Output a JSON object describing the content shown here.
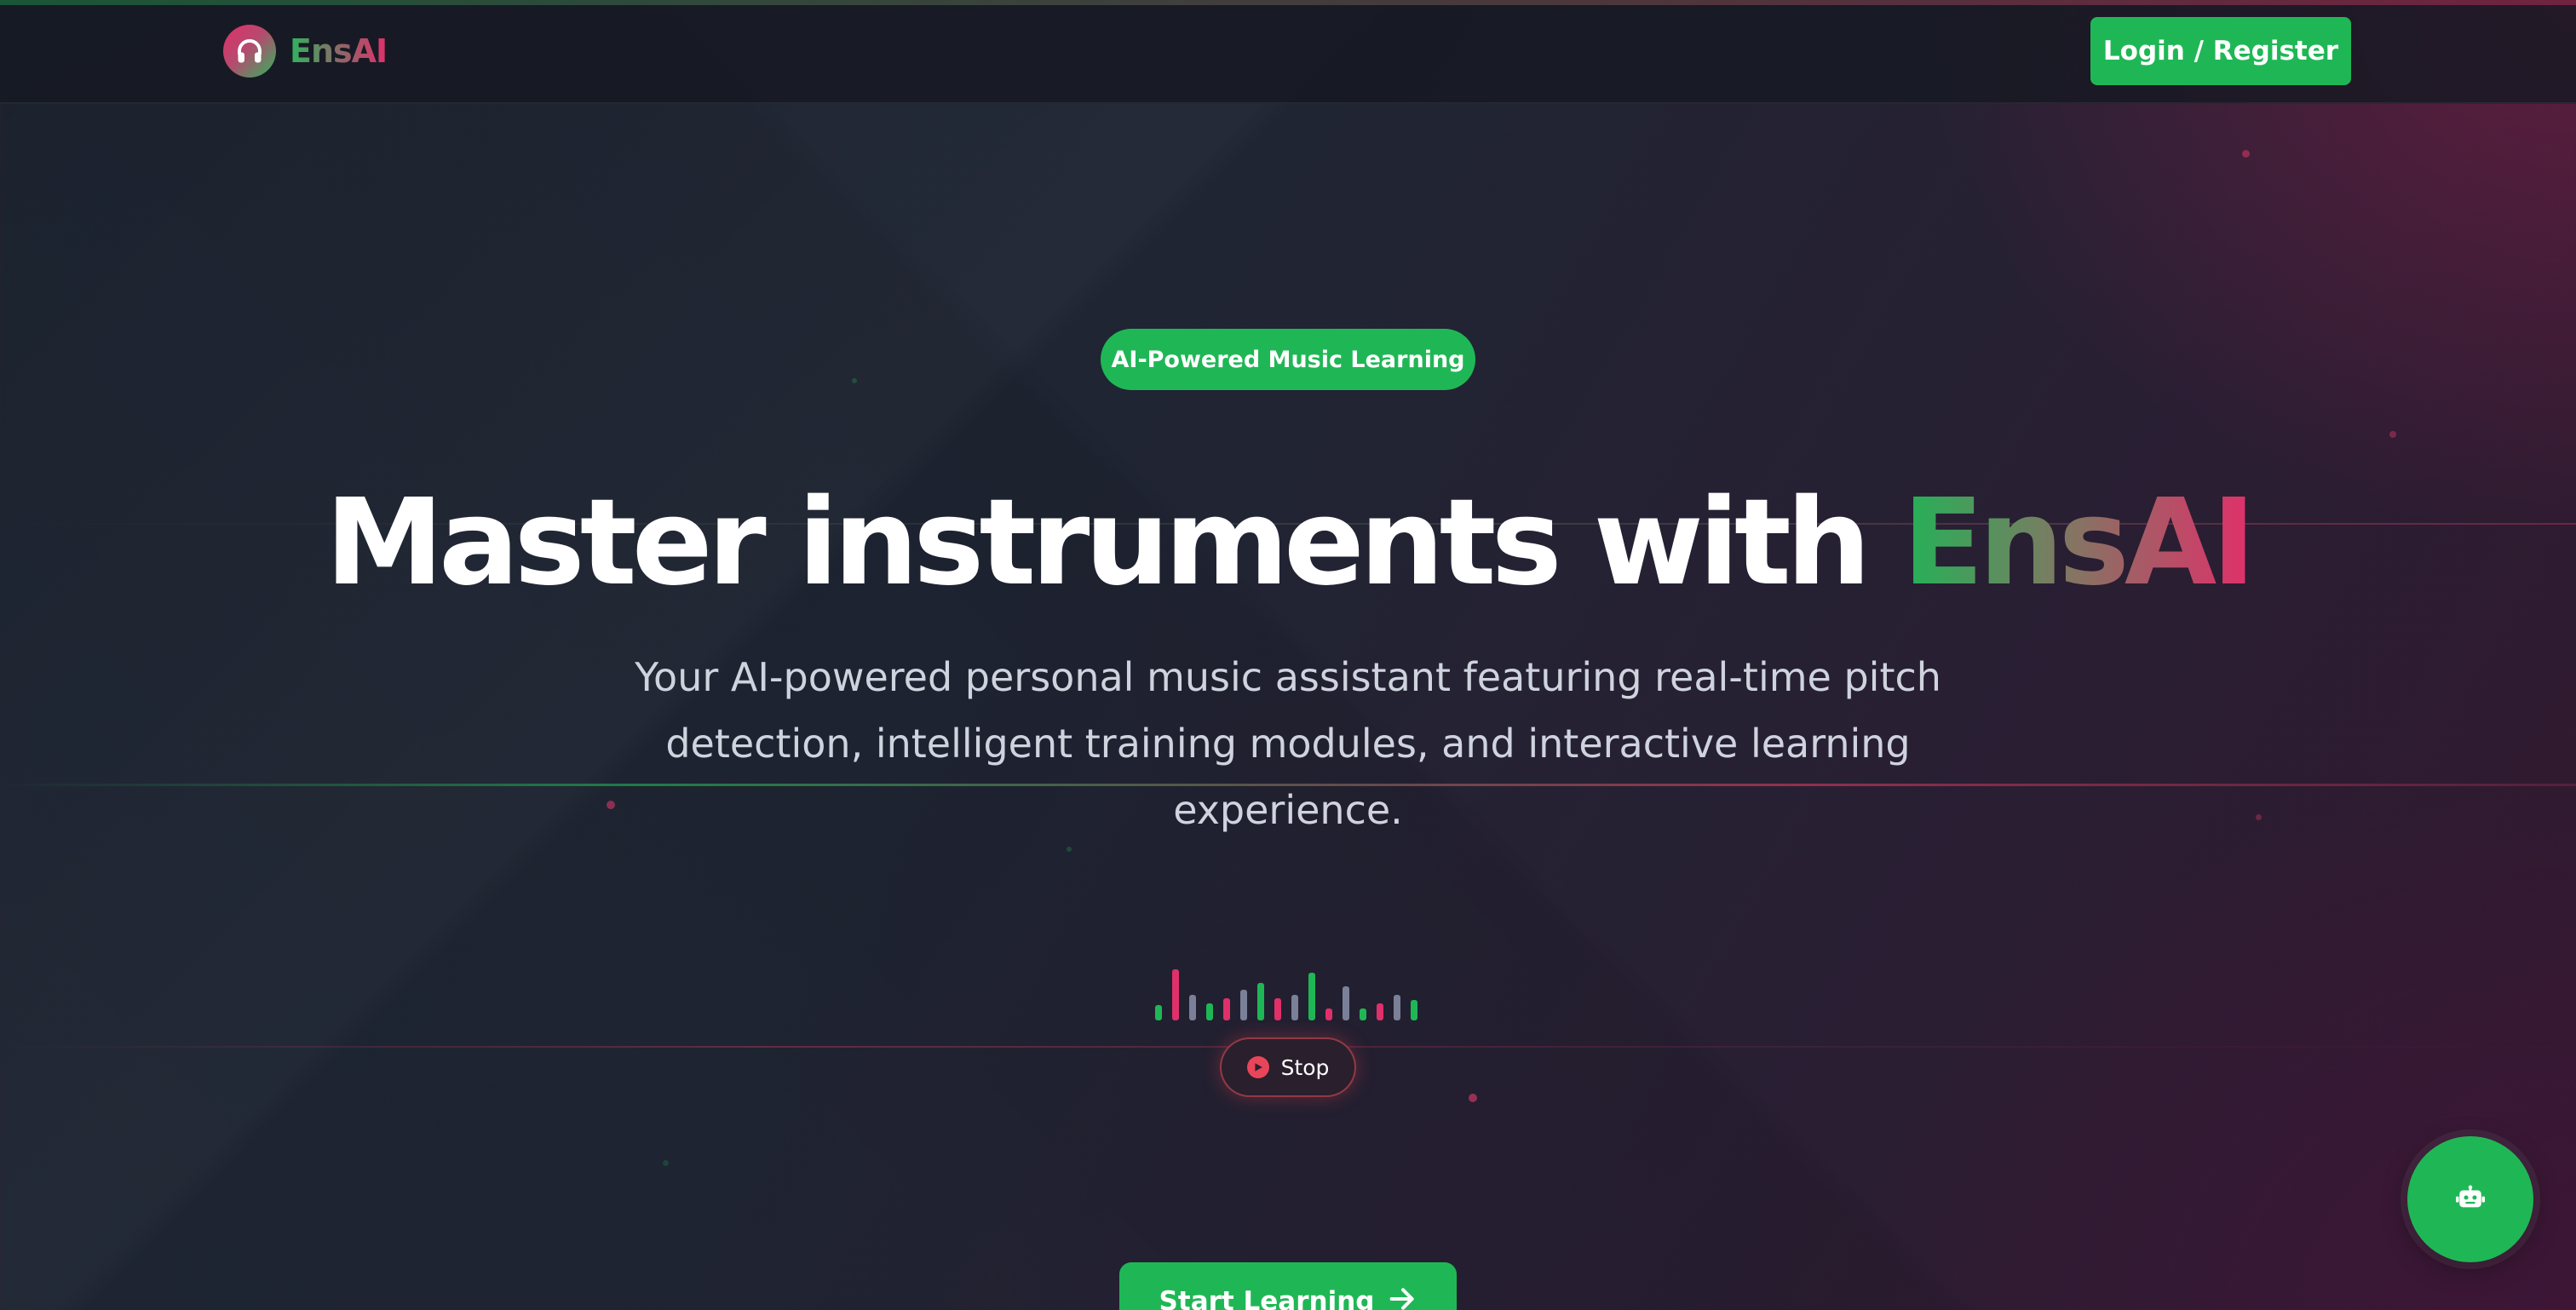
{
  "header": {
    "brand_name": "EnsAI",
    "logo_icon": "headphones-icon",
    "login_label": "Login / Register"
  },
  "hero": {
    "badge": "AI-Powered Music Learning",
    "headline_prefix": "Master instruments with",
    "headline_brand": "EnsAI",
    "subtitle": "Your AI-powered personal music assistant featuring real-time pitch detection, intelligent training modules, and interactive learning experience."
  },
  "player": {
    "stop_label": "Stop",
    "stop_icon": "play-circle-icon"
  },
  "cta": {
    "start_label": "Start Learning",
    "arrow_icon": "arrow-right-icon"
  },
  "chat": {
    "icon": "robot-icon"
  },
  "colors": {
    "accent_green": "#1fb755",
    "accent_pink": "#e0306a",
    "bar_gray": "#7a8098"
  }
}
